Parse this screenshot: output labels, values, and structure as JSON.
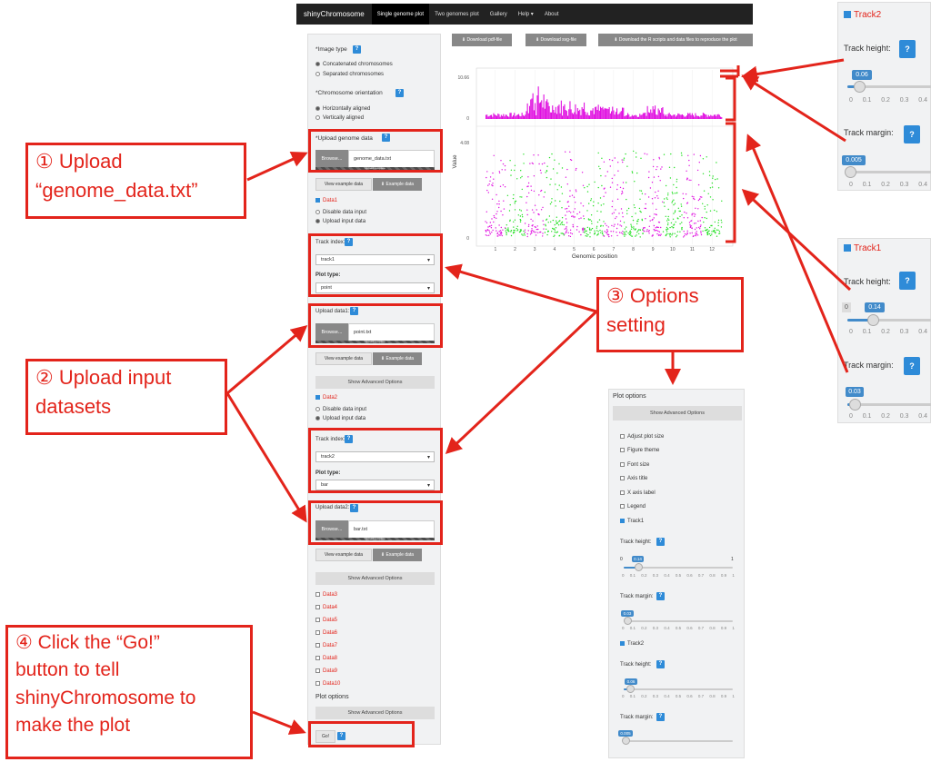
{
  "navbar": {
    "brand": "shinyChromosome",
    "items": [
      "Single genome plot",
      "Two genomes plot",
      "Gallery",
      "Help ▾",
      "About"
    ]
  },
  "sidebar": {
    "image_type_label": "*Image type",
    "image_type_options": [
      "Concatenated chromosomes",
      "Separated chromosomes"
    ],
    "orientation_label": "*Chromosome orientation",
    "orientation_options": [
      "Horizontally aligned",
      "Vertically aligned"
    ],
    "upload_genome_label": "*Upload genome data",
    "browse": "Browse...",
    "genome_file": "genome_data.txt",
    "upload_complete": "Upload complete",
    "view_example": "View example data",
    "example_data": "⬇ Example data",
    "data1_label": "Data1",
    "disable_input": "Disable data input",
    "upload_input": "Upload input data",
    "track_index_label": "Track index:",
    "track1": "track1",
    "plot_type_label": "Plot type:",
    "plot_type1": "point",
    "upload_data1_label": "Upload data1:",
    "data1_file": "point.txt",
    "show_advanced": "Show Advanced Options",
    "data2_label": "Data2",
    "track2": "track2",
    "plot_type2": "bar",
    "upload_data2_label": "Upload data2:",
    "data2_file": "bar.txt",
    "data_more": [
      "Data3",
      "Data4",
      "Data5",
      "Data6",
      "Data7",
      "Data8",
      "Data9",
      "Data10"
    ],
    "plot_options_label": "Plot options",
    "go": "Go!",
    "help_q": "?"
  },
  "download": {
    "pdf": "⬇ Download pdf-file",
    "svg": "⬇ Download svg-file",
    "scripts": "⬇ Download the R scripts and data files to reproduce the plot"
  },
  "chart_data": {
    "type": "scatter",
    "xlabel": "Genomic position",
    "ylabel": "Value",
    "categories": [
      "1",
      "2",
      "3",
      "4",
      "5",
      "6",
      "7",
      "8",
      "9",
      "10",
      "11",
      "12"
    ],
    "tracks": [
      {
        "name": "track2",
        "kind": "bar",
        "ymax_label": "10.66",
        "ymin_label": "0",
        "color": "#e00fe0"
      },
      {
        "name": "track1",
        "kind": "point",
        "ymax_label": "4.08",
        "ymin_label": "0",
        "colors": [
          "#e00fe0",
          "#22e022"
        ]
      }
    ]
  },
  "callouts": {
    "c1_line1": "① Upload",
    "c1_line2": "“genome_data.txt”",
    "c2_line1": "② Upload input",
    "c2_line2": "datasets",
    "c3_line1": "③ Options",
    "c3_line2": "setting",
    "c4_line1": "④ Click the “Go!”",
    "c4_line2": "button to tell",
    "c4_line3": "shinyChromosome to",
    "c4_line4": "make the plot"
  },
  "track2_panel": {
    "title": "Track2",
    "height_label": "Track height:",
    "height_value": "0.06",
    "margin_label": "Track margin:",
    "margin_value": "0.005",
    "ticks": [
      "0",
      "0.1",
      "0.2",
      "0.3",
      "0.4"
    ]
  },
  "track1_panel": {
    "title": "Track1",
    "height_label": "Track height:",
    "height_value": "0.14",
    "height_min": "0",
    "margin_label": "Track margin:",
    "margin_value": "0.03",
    "ticks": [
      "0",
      "0.1",
      "0.2",
      "0.3",
      "0.4"
    ]
  },
  "plot_options": {
    "title": "Plot options",
    "show_advanced": "Show Advanced Options",
    "items": [
      "Adjust plot size",
      "Figure theme",
      "Font size",
      "Axis title",
      "X axis label",
      "Legend"
    ],
    "track1": "Track1",
    "track2": "Track2",
    "height_label": "Track height:",
    "margin_label": "Track margin:",
    "t1_height": "0.14",
    "t1_margin": "0.03",
    "t2_height": "0.06",
    "t2_margin": "0.005",
    "min": "0",
    "max": "1",
    "ticks": [
      "0",
      "0.1",
      "0.2",
      "0.3",
      "0.4",
      "0.5",
      "0.6",
      "0.7",
      "0.8",
      "0.9",
      "1"
    ]
  },
  "colors": {
    "accent": "#2e8bd8",
    "annotation": "#e3241b",
    "navbar": "#222222"
  }
}
